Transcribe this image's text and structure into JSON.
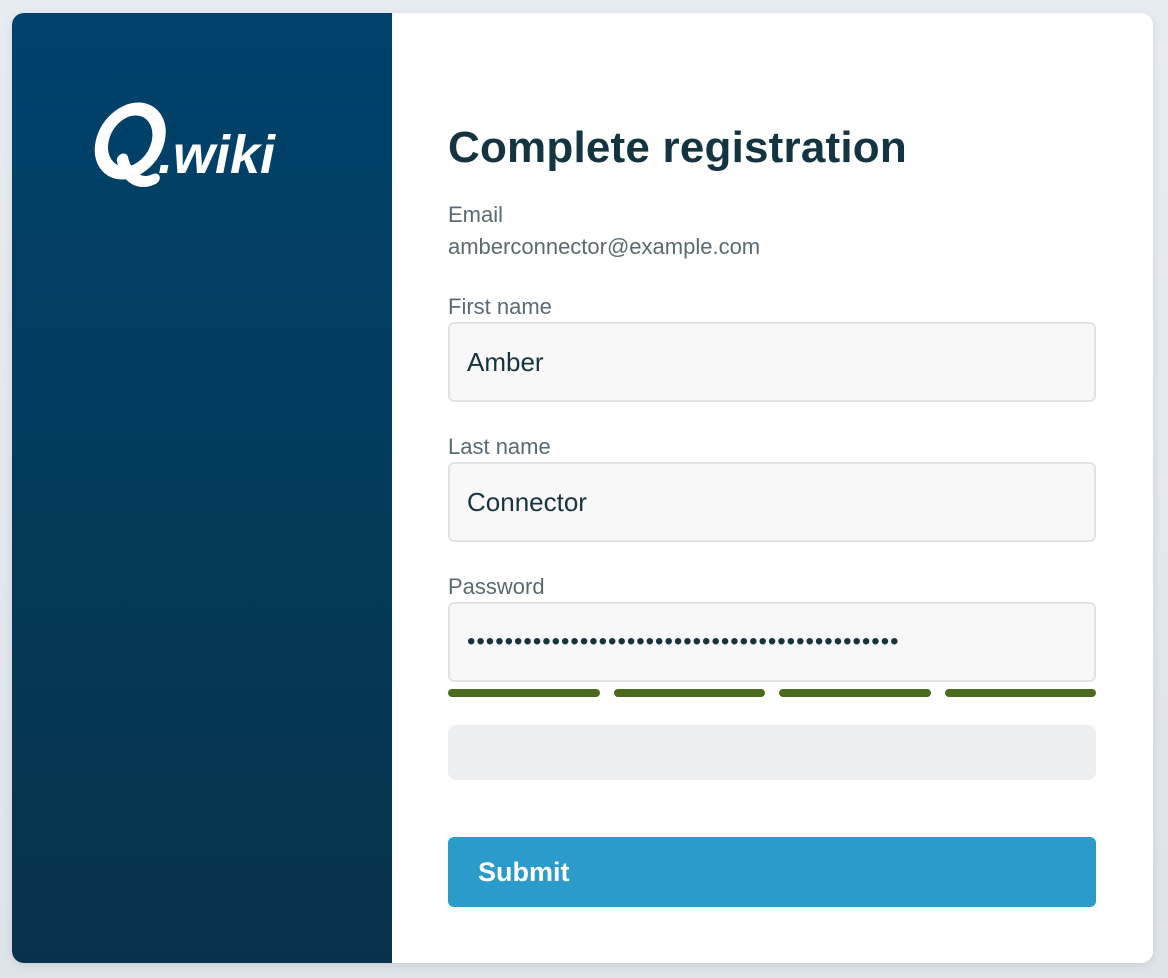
{
  "brand": {
    "logo_text": "Q.wiki",
    "logo_icon": "q-logo-icon",
    "colors": {
      "sidebar_top": "#00426d",
      "sidebar_bottom": "#07334a",
      "accent": "#2a9bca",
      "strength": "#4a6b1e"
    }
  },
  "form": {
    "title": "Complete registration",
    "email_label": "Email",
    "email_value": "amberconnector@example.com",
    "first_name_label": "First name",
    "first_name_value": "Amber",
    "last_name_label": "Last name",
    "last_name_value": "Connector",
    "password_label": "Password",
    "password_value": "••••••••••••••••••••••••••••••••••••••••••••••",
    "password_strength": {
      "filled": 4,
      "total": 4
    },
    "hint_text": "",
    "submit_label": "Submit"
  }
}
